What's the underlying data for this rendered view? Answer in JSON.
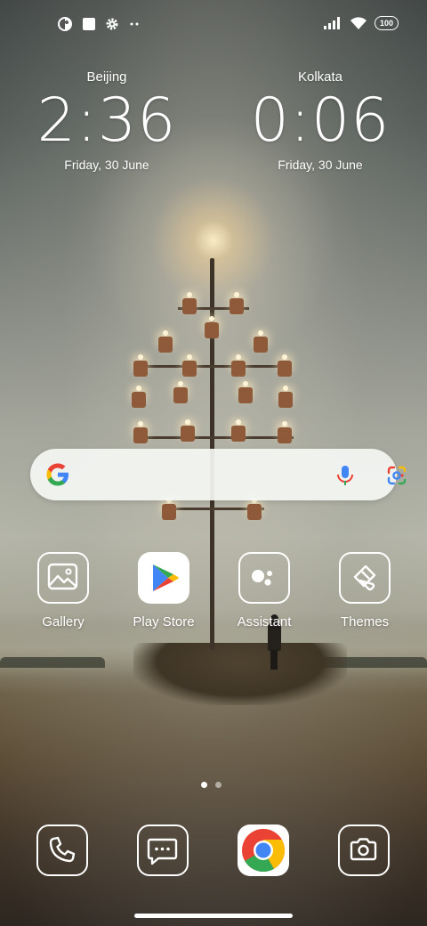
{
  "status_bar": {
    "left_icons": [
      "app-indicator-icon",
      "square-notification-icon",
      "settings-gear-icon",
      "more-dots-icon"
    ],
    "right_icons": [
      "signal-icon",
      "wifi-icon"
    ],
    "battery": "100"
  },
  "clocks": [
    {
      "city": "Beijing",
      "time": "2:36",
      "date": "Friday, 30 June"
    },
    {
      "city": "Kolkata",
      "time": "0:06",
      "date": "Friday, 30 June"
    }
  ],
  "search_bar": {
    "icons": [
      "google-g-icon",
      "microphone-icon",
      "google-lens-icon"
    ]
  },
  "apps": [
    {
      "label": "Gallery",
      "icon": "gallery-icon"
    },
    {
      "label": "Play Store",
      "icon": "play-store-icon"
    },
    {
      "label": "Assistant",
      "icon": "assistant-icon"
    },
    {
      "label": "Themes",
      "icon": "themes-brush-icon"
    }
  ],
  "page_indicator": {
    "pages": 2,
    "current": 1
  },
  "dock": [
    {
      "name": "Phone",
      "icon": "phone-icon"
    },
    {
      "name": "Messages",
      "icon": "messages-icon"
    },
    {
      "name": "Chrome",
      "icon": "chrome-icon"
    },
    {
      "name": "Camera",
      "icon": "camera-icon"
    }
  ],
  "colors": {
    "google_blue": "#4285F4",
    "google_red": "#EA4335",
    "google_yellow": "#FBBC05",
    "google_green": "#34A853"
  }
}
